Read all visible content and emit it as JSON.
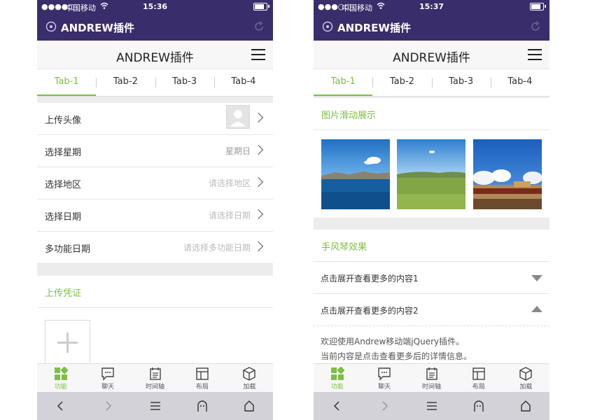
{
  "colors": {
    "appbar": "#3a2d6b",
    "accent": "#7cc043",
    "divider": "#ececec",
    "browserbar": "#d2d2d8"
  },
  "left": {
    "status": {
      "signal": "●●●●○",
      "carrier": "中国移动",
      "time": "15:36"
    },
    "appbar": {
      "title": "ANDREW插件"
    },
    "header": {
      "title": "ANDREW插件"
    },
    "tabs": [
      "Tab-1",
      "Tab-2",
      "Tab-3",
      "Tab-4"
    ],
    "rows": [
      {
        "label": "上传头像",
        "value": ""
      },
      {
        "label": "选择星期",
        "value": "星期日"
      },
      {
        "label": "选择地区",
        "value": "请选择地区"
      },
      {
        "label": "选择日期",
        "value": "请选择日期"
      },
      {
        "label": "多功能日期",
        "value": "请选择多功能日期"
      }
    ],
    "section_title": "上传凭证"
  },
  "right": {
    "status": {
      "signal": "●●●○○",
      "carrier": "中国移动",
      "time": "15:37"
    },
    "appbar": {
      "title": "ANDREW插件"
    },
    "header": {
      "title": "ANDREW插件"
    },
    "tabs": [
      "Tab-1",
      "Tab-2",
      "Tab-3",
      "Tab-4"
    ],
    "gallery_title": "图片滑动展示",
    "gallery_images": [
      "lake-landscape",
      "grassland-landscape",
      "temple-landscape"
    ],
    "accordion_title": "手风琴效果",
    "accordion": [
      {
        "label": "点击展开查看更多的内容1",
        "expanded": false
      },
      {
        "label": "点击展开查看更多的内容2",
        "expanded": true
      }
    ],
    "accordion_body": [
      "欢迎使用Andrew移动端jQuery插件。",
      "当前内容是点击查看更多后的详情信息。"
    ]
  },
  "tabbar": [
    {
      "label": "功能",
      "icon": "grid-icon",
      "active": true
    },
    {
      "label": "聊天",
      "icon": "chat-icon",
      "active": false
    },
    {
      "label": "时间轴",
      "icon": "timeline-icon",
      "active": false
    },
    {
      "label": "布局",
      "icon": "layout-icon",
      "active": false
    },
    {
      "label": "加载",
      "icon": "box-icon",
      "active": false
    }
  ],
  "browser_icons": [
    "back-icon",
    "forward-icon",
    "menu-icon",
    "ghost-icon",
    "home-icon"
  ]
}
